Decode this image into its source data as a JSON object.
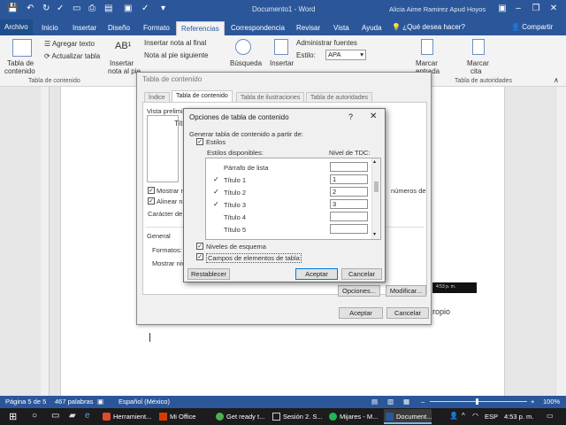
{
  "window": {
    "title": "Documento1 - Word",
    "user": "Alicia Aime Ramirez Apud Hoyos",
    "colors": {
      "accent": "#2b579a",
      "dialog_bg": "#f0f0f0"
    }
  },
  "ribbon_tabs": [
    "Archivo",
    "Inicio",
    "Insertar",
    "Diseño",
    "Formato",
    "Referencias",
    "Correspondencia",
    "Revisar",
    "Vista",
    "Ayuda"
  ],
  "tell_me": "¿Qué desea hacer?",
  "share": "Compartir",
  "ribbon": {
    "toc_btn": [
      "Tabla de",
      "contenido"
    ],
    "add_text": "Agregar texto",
    "update_table": "Actualizar tabla",
    "footnote": [
      "Insertar",
      "nota al pie"
    ],
    "insert_endnote": "Insertar nota al final",
    "next_footnote": "Nota al pie siguiente",
    "search": "Búsqueda",
    "insert": "Insertar",
    "manage_sources": "Administrar fuentes",
    "style_label": "Estilo:",
    "style_value": "APA",
    "mark_btn": [
      "Marcar",
      "entrada"
    ],
    "mark_cite": [
      "Marcar",
      "cita"
    ],
    "group_toc": "Tabla de contenido",
    "group_authorities": "Tabla de autoridades"
  },
  "toc_dialog": {
    "title": "Tabla de contenido",
    "tabs": [
      "Índice",
      "Tabla de contenido",
      "Tabla de ilustraciones",
      "Tabla de autoridades"
    ],
    "preview_label": "Vista prelimin",
    "preview_text": "Títu",
    "show_numbers": "Mostrar n",
    "align_numbers": "Alinear n",
    "leader": "Carácter de r",
    "web_numbers": "números de",
    "general": "General",
    "formats": "Formatos:",
    "show_levels": "Mostrar niv",
    "options_btn": "Opciones...",
    "modify_btn": "Modificar...",
    "ok": "Aceptar",
    "cancel": "Cancelar"
  },
  "options_dialog": {
    "title": "Opciones de tabla de contenido",
    "build_from": "Generar tabla de contenido a partir de:",
    "styles": "Estilos",
    "available_styles": "Estilos disponibles:",
    "toc_level": "Nivel de TDC:",
    "rows": [
      {
        "style": "Párrafo de lista",
        "checked": false,
        "level": ""
      },
      {
        "style": "Título 1",
        "checked": true,
        "level": "1"
      },
      {
        "style": "Título 2",
        "checked": true,
        "level": "2"
      },
      {
        "style": "Título 3",
        "checked": true,
        "level": "3"
      },
      {
        "style": "Título 4",
        "checked": false,
        "level": ""
      },
      {
        "style": "Título 5",
        "checked": false,
        "level": ""
      }
    ],
    "outline_levels": "Niveles de esquema",
    "table_entry_fields": "Campos de elementos de tabla",
    "reset": "Restablecer",
    "ok": "Aceptar",
    "cancel": "Cancelar"
  },
  "document": {
    "text_right": "ropio",
    "thumb_time": "4:53 p. m."
  },
  "statusbar": {
    "page": "Página 5 de 5",
    "words": "467 palabras",
    "language": "Español (México)",
    "zoom": "100%"
  },
  "taskbar": {
    "items": [
      "Herramient...",
      "Mi Office",
      "Get ready t...",
      "Sesión 2. S...",
      "Mijares - M...",
      "Document..."
    ],
    "language": "ESP",
    "time": "4:53 p. m."
  }
}
